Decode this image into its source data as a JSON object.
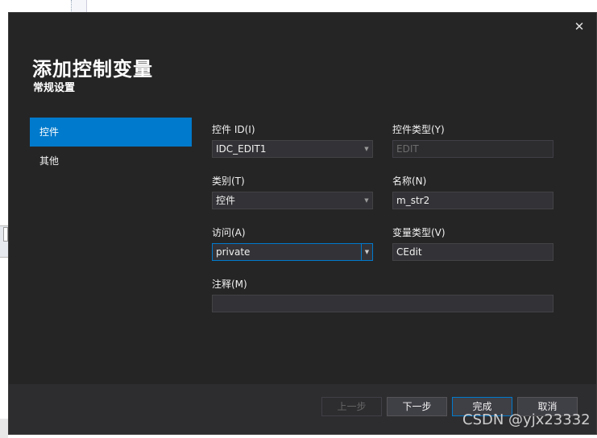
{
  "dialog": {
    "title": "添加控制变量",
    "subtitle": "常规设置",
    "close_glyph": "✕"
  },
  "nav": {
    "items": [
      {
        "label": "控件",
        "active": true
      },
      {
        "label": "其他",
        "active": false
      }
    ]
  },
  "form": {
    "control_id": {
      "label": "控件 ID(I)",
      "value": "IDC_EDIT1"
    },
    "control_type": {
      "label": "控件类型(Y)",
      "value": "EDIT"
    },
    "category": {
      "label": "类别(T)",
      "value": "控件"
    },
    "name": {
      "label": "名称(N)",
      "value": "m_str2"
    },
    "access": {
      "label": "访问(A)",
      "value": "private"
    },
    "var_type": {
      "label": "变量类型(V)",
      "value": "CEdit"
    },
    "comment": {
      "label": "注释(M)",
      "value": ""
    }
  },
  "footer": {
    "prev_label": "上一步",
    "next_label": "下一步",
    "finish_label": "完成",
    "cancel_label": "取消"
  },
  "watermark": "CSDN @yjx23332",
  "colors": {
    "accent": "#007acc",
    "dialog_bg": "#252526",
    "field_bg": "#333337"
  }
}
